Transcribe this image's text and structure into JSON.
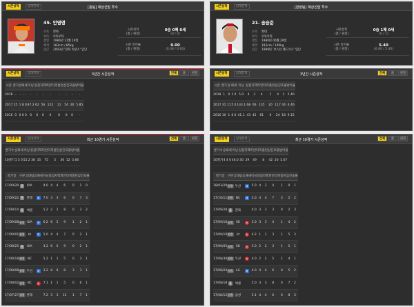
{
  "players": [
    {
      "tabs": [
        "시즌성적",
        "상대전적"
      ],
      "header_note": "[홈팀] 예상선발 투수",
      "name": "45. 안영명",
      "info": [
        {
          "k": "소속",
          "v": "한화"
        },
        {
          "k": "투타",
          "v": "우투우타"
        },
        {
          "k": "생일",
          "v": "1984년 11월 19일"
        },
        {
          "k": "체격",
          "v": "183cm / 85kg"
        },
        {
          "k": "입단",
          "v": "2003년 '한화 이글스' 입단"
        }
      ],
      "record": [
        {
          "label": "시즌성적",
          "sub": "(홈 / 원정)",
          "value": "0승 0패 0세",
          "value_sub": "(0 / 0)"
        },
        {
          "label": "시즌 방어율",
          "sub": "(홈 / 원정)",
          "value": "0.00",
          "value_sub": "(0.00 / 0.00)"
        }
      ]
    },
    {
      "tabs": [
        "시즌성적",
        "상대전적"
      ],
      "header_note": "[원정팀] 예상선발 투수",
      "name": "21. 송승준",
      "info": [
        {
          "k": "소속",
          "v": "롯데"
        },
        {
          "k": "투타",
          "v": "우투우타"
        },
        {
          "k": "생일",
          "v": "1980년 06월 29일"
        },
        {
          "k": "체격",
          "v": "183cm / 100kg"
        },
        {
          "k": "입단",
          "v": "1999년 '보스턴 레드삭스' 입단"
        }
      ],
      "record": [
        {
          "label": "시즌성적",
          "sub": "(홈 / 원정)",
          "value": "0승 1패 0세",
          "value_sub": "(0 / 1)"
        },
        {
          "label": "시즌 방어율",
          "sub": "(홈 / 원정)",
          "value": "5.40",
          "value_sub": "(0.00 / 5.40)"
        }
      ]
    }
  ],
  "three_year": [
    {
      "title": "3년간 시즌성적",
      "filters": [
        "전체",
        "홈",
        "원정"
      ],
      "headers": [
        "시즌",
        "경기",
        "승",
        "패",
        "세",
        "이닝",
        "실점",
        "자책",
        "피안타",
        "피홈런",
        "삼진",
        "포볼",
        "방어율"
      ],
      "rows": [
        [
          "2018",
          "-",
          "-",
          "-",
          "-",
          "-",
          "-",
          "-",
          "-",
          "-",
          "-",
          "-",
          "-"
        ],
        [
          "2017",
          "25",
          "1",
          "8",
          "0",
          "87.2",
          "62",
          "56",
          "122",
          "11",
          "54",
          "26",
          "5.85"
        ],
        [
          "2016",
          "0",
          "0",
          "0",
          "0",
          "0",
          "0",
          "0",
          "0",
          "0",
          "0",
          "0",
          "-"
        ]
      ]
    },
    {
      "title": "3년간 시즌성적",
      "filters": [
        "전체",
        "홈",
        "원정"
      ],
      "headers": [
        "시즌",
        "경기",
        "승",
        "패",
        "세",
        "이닝",
        "실점",
        "자책",
        "피안타",
        "피홈런",
        "삼진",
        "포볼",
        "방어율"
      ],
      "rows": [
        [
          "2018",
          "1",
          "0",
          "1",
          "0",
          "5.0",
          "4",
          "3",
          "4",
          "1",
          "0",
          "1",
          "5.40"
        ],
        [
          "2017",
          "31",
          "11",
          "5",
          "0",
          "133.1",
          "68",
          "66",
          "135",
          "20",
          "117",
          "44",
          "4.46"
        ],
        [
          "2016",
          "10",
          "1",
          "6",
          "0",
          "41.1",
          "43",
          "42",
          "61",
          "6",
          "24",
          "18",
          "9.15"
        ]
      ]
    }
  ],
  "last10": [
    {
      "title": "최근 10경기 시즌성적",
      "filters": [
        "전체",
        "홈",
        "원정"
      ],
      "summary_headers": [
        "경기수",
        "승",
        "패",
        "세",
        "이닝",
        "실점",
        "자책",
        "피안타",
        "피홈런",
        "삼진",
        "포볼",
        "방어율"
      ],
      "summary_row": [
        "10경기",
        "1",
        "5",
        "0",
        "55.2",
        "38",
        "35",
        "75",
        "5",
        "36",
        "12",
        "5.66"
      ],
      "headers": [
        "경기일",
        "구분",
        "상대팀",
        "승패세",
        "이닝",
        "실점",
        "자책",
        "피안타",
        "피홈런",
        "삼진",
        "포볼"
      ],
      "rows": [
        [
          "17/09/29",
          "홈",
          "KIA",
          "",
          "4.0",
          "4",
          "4",
          "6",
          "0",
          "1",
          "0"
        ],
        [
          "17/09/22",
          "홈",
          "롯데",
          "패",
          "7.0",
          "3",
          "3",
          "6",
          "0",
          "7",
          "3"
        ],
        [
          "17/09/14",
          "홈",
          "넥센",
          "",
          "5.2",
          "2",
          "2",
          "8",
          "0",
          "3",
          "2"
        ],
        [
          "17/09/08",
          "원정",
          "KIA",
          "패",
          "6.2",
          "6",
          "5",
          "9",
          "1",
          "2",
          "1"
        ],
        [
          "17/09/01",
          "원정",
          "kt",
          "패",
          "5.0",
          "4",
          "4",
          "7",
          "0",
          "2",
          "1"
        ],
        [
          "17/08/25",
          "홈",
          "KIA",
          "",
          "3.2",
          "6",
          "6",
          "9",
          "0",
          "2",
          "1"
        ],
        [
          "17/08/18",
          "원정",
          "NC",
          "",
          "5.2",
          "1",
          "1",
          "5",
          "0",
          "3",
          "1"
        ],
        [
          "17/08/08",
          "원정",
          "두산",
          "패",
          "3.2",
          "8",
          "8",
          "8",
          "3",
          "3",
          "1"
        ],
        [
          "17/08/02",
          "원정",
          "NC",
          "승",
          "7.1",
          "1",
          "1",
          "5",
          "0",
          "6",
          "1"
        ],
        [
          "17/07/27",
          "원정",
          "롯데",
          "",
          "7.2",
          "3",
          "3",
          "12",
          "1",
          "7",
          "1"
        ]
      ]
    },
    {
      "title": "최근 10경기 시즌성적",
      "filters": [
        "전체",
        "홈",
        "원정"
      ],
      "summary_headers": [
        "경기수",
        "승",
        "패",
        "세",
        "이닝",
        "실점",
        "자책",
        "피안타",
        "피홈런",
        "삼진",
        "포볼",
        "방어율"
      ],
      "summary_row": [
        "10경기",
        "4",
        "4",
        "0",
        "46.0",
        "30",
        "29",
        "49",
        "8",
        "42",
        "20",
        "5.67"
      ],
      "headers": [
        "경기일",
        "구분",
        "상대팀",
        "승패세",
        "이닝",
        "실점",
        "자책",
        "피안타",
        "피홈런",
        "삼진",
        "포볼"
      ],
      "rows": [
        [
          "18/03/29",
          "원정",
          "두산",
          "패",
          "5.0",
          "4",
          "3",
          "4",
          "1",
          "0",
          "1"
        ],
        [
          "17/10/11",
          "원정",
          "NC",
          "패",
          "4.0",
          "4",
          "4",
          "7",
          "3",
          "2",
          "2"
        ],
        [
          "17/09/28",
          "홈",
          "한화",
          "",
          "4.0",
          "3",
          "3",
          "3",
          "0",
          "2",
          "3"
        ],
        [
          "17/09/16",
          "원정",
          "SK",
          "승",
          "5.0",
          "3",
          "3",
          "4",
          "1",
          "4",
          "2"
        ],
        [
          "17/09/10",
          "원정",
          "kt",
          "승",
          "4.2",
          "1",
          "1",
          "3",
          "1",
          "5",
          "3"
        ],
        [
          "17/09/05",
          "원정",
          "SK",
          "승",
          "5.0",
          "2",
          "2",
          "3",
          "1",
          "5",
          "1"
        ],
        [
          "17/08/30",
          "원정",
          "두산",
          "승",
          "4.0",
          "2",
          "2",
          "5",
          "1",
          "4",
          "1"
        ],
        [
          "17/08/24",
          "원정",
          "LG",
          "패",
          "4.0",
          "4",
          "4",
          "6",
          "0",
          "5",
          "2"
        ],
        [
          "17/08/18",
          "홈",
          "넥센",
          "",
          "5.0",
          "3",
          "3",
          "8",
          "0",
          "7",
          "2"
        ],
        [
          "17/08/12",
          "원정",
          "삼성",
          "",
          "5.1",
          "4",
          "4",
          "6",
          "0",
          "8",
          "3"
        ]
      ]
    }
  ],
  "colors": {
    "accent": "#f3ce1a",
    "red": "#c8102e",
    "blue": "#2a6ad8",
    "panel": "#2d2d2d"
  }
}
